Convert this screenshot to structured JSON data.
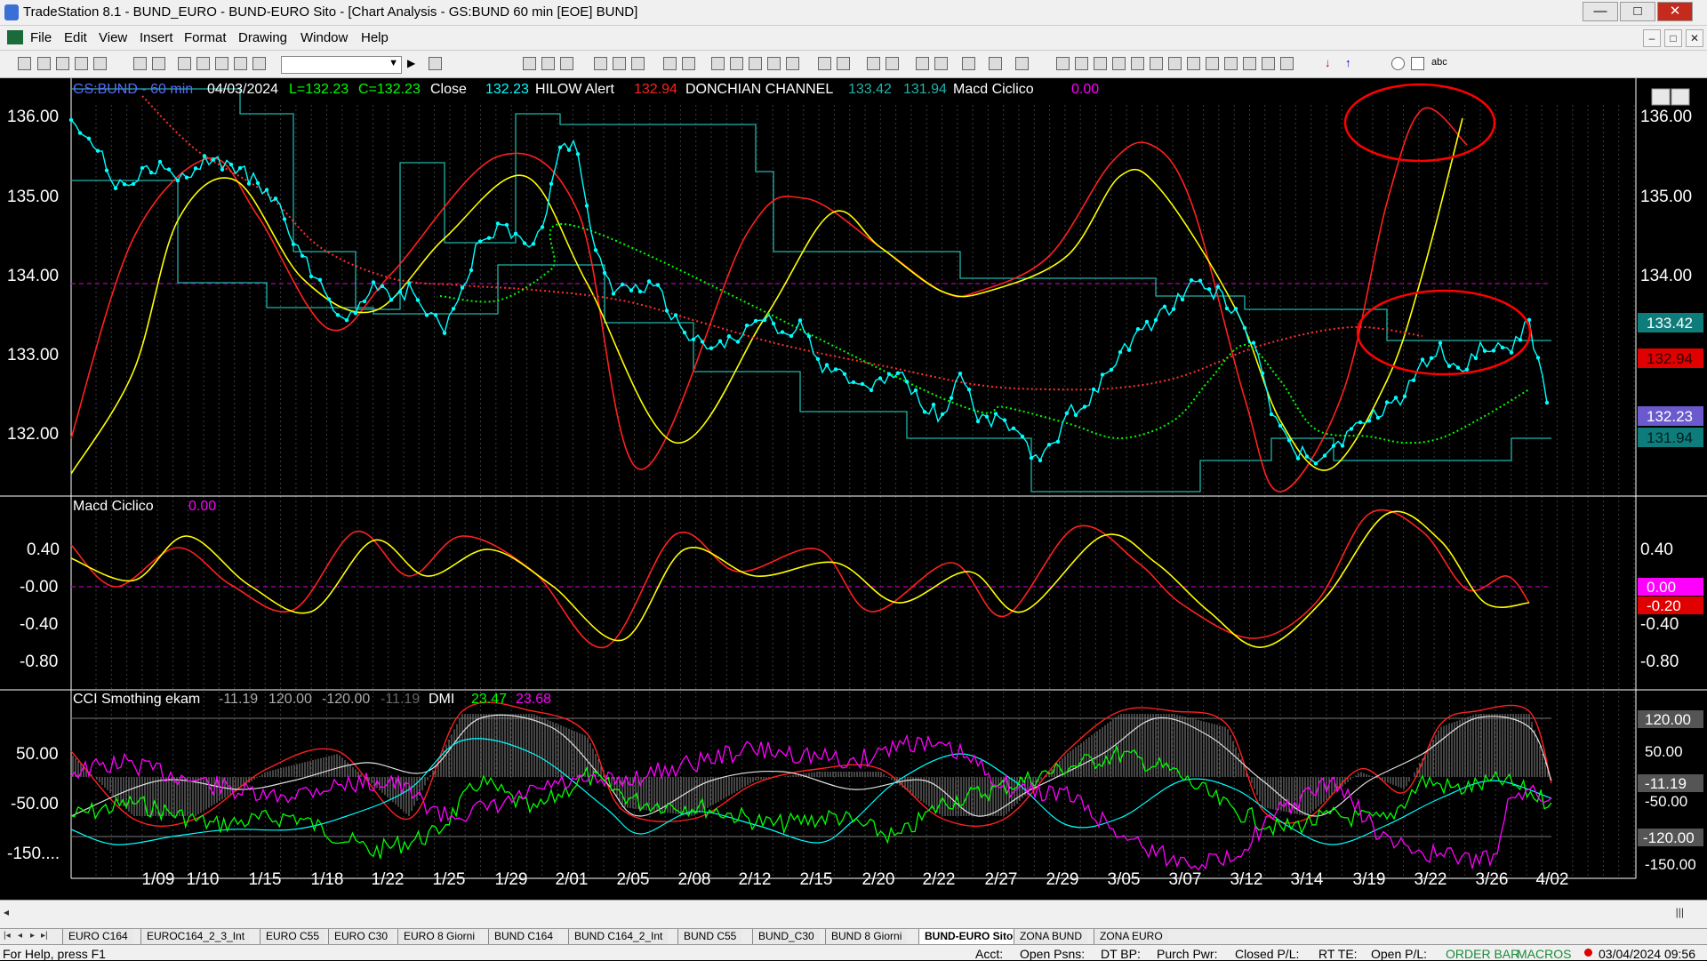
{
  "window": {
    "title": "TradeStation 8.1 - BUND_EURO - BUND-EURO Sito - [Chart Analysis - GS:BUND  60 min  [EOE] BUND]",
    "buttons": {
      "minimize": "—",
      "maximize": "□",
      "close": "✕"
    }
  },
  "menu": [
    "File",
    "Edit",
    "View",
    "Insert",
    "Format",
    "Drawing",
    "Window",
    "Help"
  ],
  "mdi_buttons": [
    "–",
    "□",
    "✕"
  ],
  "toolbar": {
    "symbol_value": ""
  },
  "chart": {
    "header": {
      "symbol": "GS:BUND - 60 min",
      "date": "04/03/2024",
      "low": "L=132.23",
      "close_eq": "C=132.23",
      "close_label": "Close",
      "close_value": "132.23",
      "hilow_label": "HILOW Alert",
      "hilow_value": "132.94",
      "donchian_label": "DONCHIAN CHANNEL",
      "donchian_upper": "133.42",
      "donchian_lower": "131.94",
      "macd_label": "Macd Ciclico",
      "macd_value": "0.00"
    },
    "colors": {
      "background": "#000000",
      "price": "#00ffff",
      "red_cycle": "#ff2020",
      "yellow_cycle": "#ffff00",
      "donchian": "#20b2aa",
      "dotted_red": "#ff3030",
      "dotted_green": "#00ff00",
      "magenta": "#ff00ff",
      "annotation_red": "#ff0000"
    },
    "price_axis": {
      "ticks": [
        "136.00",
        "135.00",
        "134.00",
        "133.00",
        "132.00"
      ],
      "markers": [
        {
          "label": "133.42",
          "color": "#0e7c7b"
        },
        {
          "label": "132.94",
          "color": "#e00000"
        },
        {
          "label": "132.23",
          "color": "#6a5acd"
        },
        {
          "label": "131.94",
          "color": "#0e7c7b"
        }
      ]
    },
    "macd_panel": {
      "label": "Macd Ciclico",
      "value": "0.00",
      "ticks": [
        "0.40",
        "-0.00",
        "-0.40",
        "-0.80"
      ],
      "markers": [
        {
          "label": "0.00",
          "color": "#ff00ff"
        },
        {
          "label": "-0.20",
          "color": "#e00000"
        }
      ]
    },
    "cci_panel": {
      "label": "CCI Smothing ekam",
      "cci_value": "-11.19",
      "upper": "120.00",
      "lower": "-120.00",
      "cci_value2": "-11.19",
      "dmi_label": "DMI",
      "dmi_plus": "23.47",
      "dmi_minus": "23.68",
      "ticks": [
        "50.00",
        "-50.00",
        "-150...."
      ],
      "markers": [
        {
          "label": "120.00",
          "color": "#555555"
        },
        {
          "label": "50.00",
          "color": "#000000"
        },
        {
          "label": "-11.19",
          "color": "#555555"
        },
        {
          "label": "-50.00",
          "color": "#000000"
        },
        {
          "label": "-120.00",
          "color": "#555555"
        },
        {
          "label": "-150.00",
          "color": "#000000"
        }
      ]
    },
    "date_axis": [
      "1/09",
      "1/10",
      "1/15",
      "1/18",
      "1/22",
      "1/25",
      "1/29",
      "2/01",
      "2/05",
      "2/08",
      "2/12",
      "2/15",
      "2/20",
      "2/22",
      "2/27",
      "2/29",
      "3/05",
      "3/07",
      "3/12",
      "3/14",
      "3/19",
      "3/22",
      "3/26",
      "4/02"
    ]
  },
  "tabs": {
    "nav": [
      "|◂",
      "◂",
      "▸",
      "▸|"
    ],
    "items": [
      "EURO C164",
      "EUROC164_2_3_Int",
      "EURO C55",
      "EURO C30",
      "EURO 8 Giorni",
      "BUND C164",
      "BUND C164_2_Int",
      "BUND C55",
      "BUND_C30",
      "BUND 8 Giorni",
      "BUND-EURO Sito",
      "ZONA BUND",
      "ZONA EURO"
    ],
    "active": "BUND-EURO Sito"
  },
  "status": {
    "help": "For Help, press F1",
    "acct": "Acct:",
    "open_psns": "Open Psns:",
    "dt_bp": "DT BP:",
    "purch_pwr": "Purch Pwr:",
    "closed_pl": "Closed P/L:",
    "rt_te": "RT TE:",
    "open_pl": "Open P/L:",
    "orderbar": "ORDER BAR",
    "macros": "MACROS",
    "datetime": "03/04/2024 09:56"
  }
}
